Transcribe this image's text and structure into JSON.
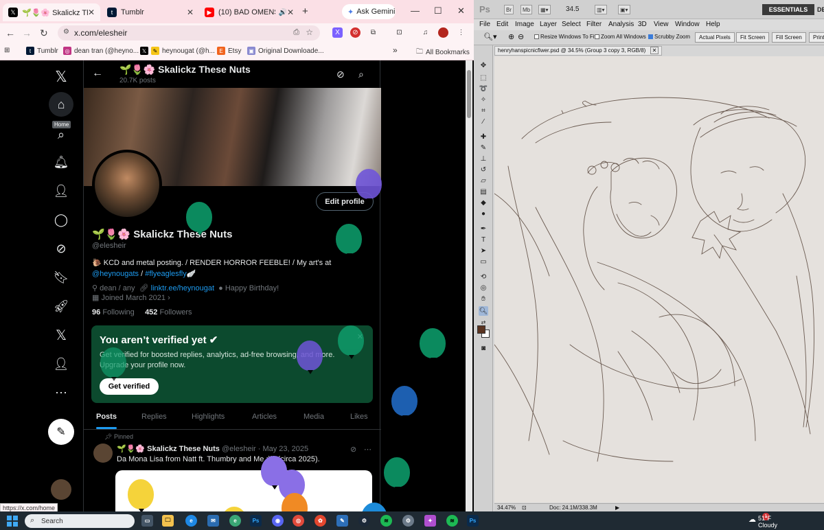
{
  "chrome": {
    "tabs": [
      {
        "label": "🌱🌷🌸 Skalickz These",
        "favicon": "x-logo",
        "color": "#000000"
      },
      {
        "label": "Tumblr",
        "favicon": "tumblr-logo",
        "color": "#001935"
      },
      {
        "label": "(10) BAD OMENS x",
        "favicon": "youtube-logo",
        "color": "#ff0000"
      }
    ],
    "new_tab": "+",
    "gemini": "Ask Gemini",
    "url": "x.com/elesheir",
    "bookmarks": [
      {
        "label": "Tumblr",
        "color": "#001935"
      },
      {
        "label": "dean tran (@heyno...",
        "color": "#c13584"
      },
      {
        "label": "",
        "color": "#000000"
      },
      {
        "label": "heynougat (@h...",
        "color": "#f5c518"
      },
      {
        "label": "Etsy",
        "color": "#f1641e"
      },
      {
        "label": "Original Downloade...",
        "color": "#8a8ad0"
      }
    ],
    "bookmarks_more": "»",
    "all_bookmarks": "All Bookmarks",
    "status_url": "https://x.com/home"
  },
  "x": {
    "nav_tooltip": "Home",
    "header": {
      "name": "🌱🌷🌸 Skalickz These Nuts",
      "posts": "20.7K posts"
    },
    "profile": {
      "name": "🌱🌷🌸 Skalickz These Nuts",
      "handle": "@elesheir",
      "bio_text": "🐌 KCD and metal posting. / RENDER HORROR FEEBLE! / My art's at",
      "bio_link1": "@heynougats",
      "bio_sep": " / ",
      "bio_link2": "#flyeaglesfly🪽",
      "meta_pronouns": "dean / any",
      "meta_link": "linktr.ee/heynougat",
      "meta_bday": "Happy Birthday!",
      "meta_joined": "Joined March 2021",
      "following_count": "96",
      "following_label": "Following",
      "followers_count": "452",
      "followers_label": "Followers",
      "edit_profile": "Edit profile"
    },
    "verify": {
      "title": "You aren’t verified yet",
      "body": "Get verified for boosted replies, analytics, ad-free browsing, and more. Upgrade your profile now.",
      "button": "Get verified"
    },
    "tabs": [
      "Posts",
      "Replies",
      "Highlights",
      "Articles",
      "Media",
      "Likes"
    ],
    "post": {
      "pinned": "Pinned",
      "name": "🌱🌷🌸 Skalickz These Nuts",
      "meta": "@elesheir · May 23, 2025",
      "text": "Da Mona Lisa from Natt ft. Thumbry and Me :))) (circa 2025)."
    }
  },
  "photoshop": {
    "logo": "Ps",
    "mini_buttons": [
      "Br",
      "Mb"
    ],
    "zoom_value": "34.5",
    "essentials": "ESSENTIALS",
    "design": "DES",
    "menu": [
      "File",
      "Edit",
      "Image",
      "Layer",
      "Select",
      "Filter",
      "Analysis",
      "3D",
      "View",
      "Window",
      "Help"
    ],
    "options": {
      "resize_windows": "Resize Windows To Fit",
      "zoom_all": "Zoom All Windows",
      "scrubby": "Scrubby Zoom",
      "actual_pixels": "Actual Pixels",
      "fit_screen": "Fit Screen",
      "fill_screen": "Fill Screen",
      "print": "Print"
    },
    "doc_tab": "henryhanspicnicflwer.psd @ 34.5% (Group 3 copy 3, RGB/8)",
    "status_zoom": "34.47%",
    "status_doc": "Doc: 24.1M/338.3M",
    "foreground_color": "#5a3320"
  },
  "taskbar": {
    "search": "Search",
    "weather_temp": "51°F",
    "weather_cond": "Cloudy",
    "notification_count": "1",
    "icons": [
      {
        "name": "task-view",
        "color": "#445566"
      },
      {
        "name": "file-explorer",
        "color": "#f2c14e"
      },
      {
        "name": "edge",
        "color": "#1e88e5"
      },
      {
        "name": "mail",
        "color": "#2b6cb0"
      },
      {
        "name": "edge-alt",
        "color": "#3aa675"
      },
      {
        "name": "photoshop-1",
        "color": "#0b2a4a"
      },
      {
        "name": "discord",
        "color": "#5865f2"
      },
      {
        "name": "chrome",
        "color": "#e24a3b"
      },
      {
        "name": "clip-studio",
        "color": "#e3472f"
      },
      {
        "name": "krita",
        "color": "#2d6fb8"
      },
      {
        "name": "steam",
        "color": "#1b2838"
      },
      {
        "name": "spotify-1",
        "color": "#1db954"
      },
      {
        "name": "settings",
        "color": "#6c7a89"
      },
      {
        "name": "copilot",
        "color": "#b04fcf"
      },
      {
        "name": "spotify-2",
        "color": "#1db954"
      },
      {
        "name": "photoshop-2",
        "color": "#0b2a4a"
      }
    ]
  }
}
